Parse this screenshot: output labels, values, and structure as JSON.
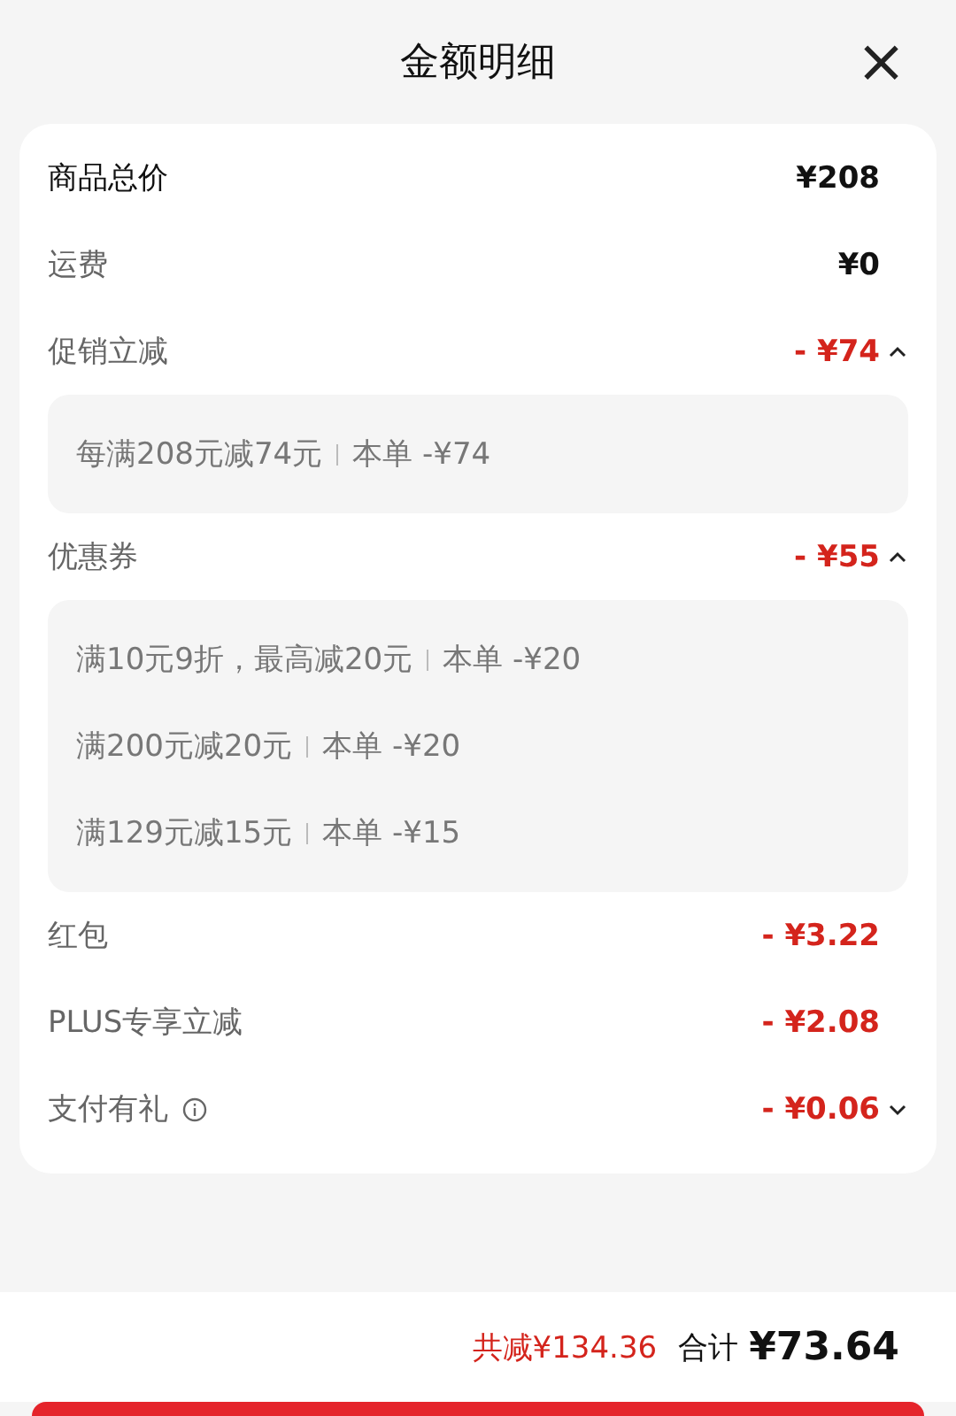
{
  "header": {
    "title": "金额明细",
    "close": "×"
  },
  "rows": [
    {
      "label": "商品总价",
      "amount": "¥208",
      "kind": "total",
      "info": false,
      "expanded": null,
      "details": []
    },
    {
      "label": "运费",
      "amount": "¥0",
      "kind": "price",
      "info": false,
      "expanded": null,
      "details": []
    },
    {
      "label": "促销立减",
      "amount": "- ¥74",
      "kind": "discount",
      "info": false,
      "expanded": true,
      "details": [
        {
          "rule": "每满208元减74元",
          "applied": "本单 -¥74"
        }
      ]
    },
    {
      "label": "优惠券",
      "amount": "- ¥55",
      "kind": "discount",
      "info": false,
      "expanded": true,
      "details": [
        {
          "rule": "满10元9折，最高减20元",
          "applied": "本单 -¥20"
        },
        {
          "rule": "满200元减20元",
          "applied": "本单 -¥20"
        },
        {
          "rule": "满129元减15元",
          "applied": "本单 -¥15"
        }
      ]
    },
    {
      "label": "红包",
      "amount": "- ¥3.22",
      "kind": "discount",
      "info": false,
      "expanded": null,
      "details": []
    },
    {
      "label": "PLUS专享立减",
      "amount": "- ¥2.08",
      "kind": "discount",
      "info": false,
      "expanded": null,
      "details": []
    },
    {
      "label": "支付有礼",
      "amount": "- ¥0.06",
      "kind": "discount",
      "info": true,
      "expanded": false,
      "details": []
    }
  ],
  "footer": {
    "saved": "共减¥134.36",
    "total_label": "合计",
    "total": "¥73.64"
  }
}
